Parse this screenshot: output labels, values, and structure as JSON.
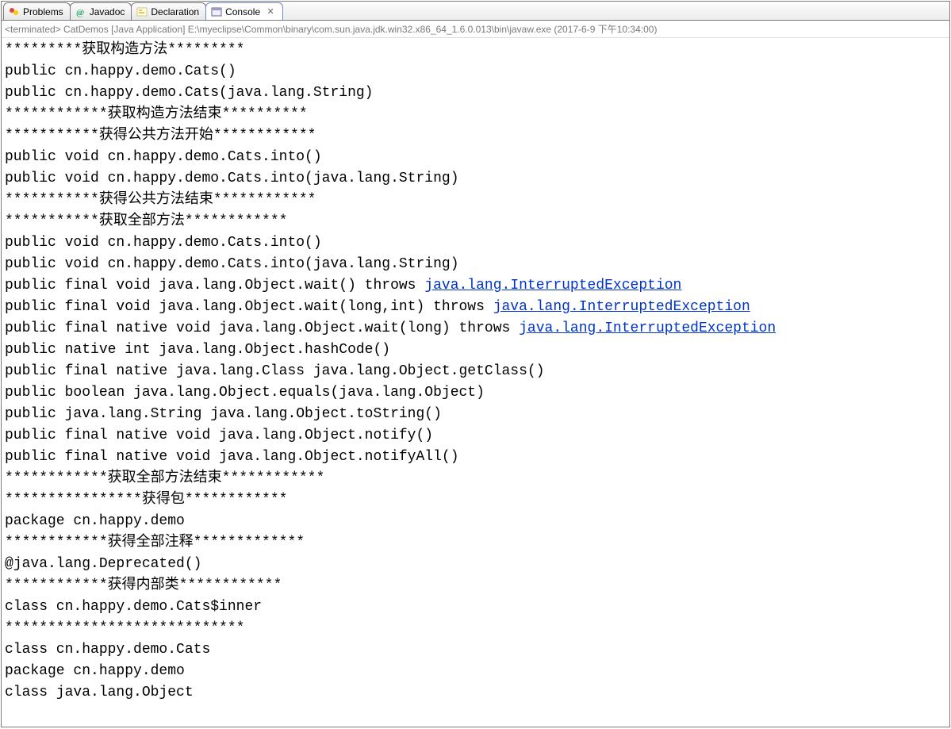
{
  "tabs": [
    {
      "id": "problems",
      "label": "Problems",
      "icon": "problems"
    },
    {
      "id": "javadoc",
      "label": "Javadoc",
      "icon": "javadoc"
    },
    {
      "id": "declaration",
      "label": "Declaration",
      "icon": "declaration"
    },
    {
      "id": "console",
      "label": "Console",
      "icon": "console",
      "active": true,
      "closable": true
    }
  ],
  "meta": "<terminated> CatDemos [Java Application] E:\\myeclipse\\Common\\binary\\com.sun.java.jdk.win32.x86_64_1.6.0.013\\bin\\javaw.exe (2017-6-9 下午10:34:00)",
  "console_lines": [
    {
      "segments": [
        {
          "text": "*********获取构造方法*********"
        }
      ]
    },
    {
      "segments": [
        {
          "text": "public cn.happy.demo.Cats()"
        }
      ]
    },
    {
      "segments": [
        {
          "text": "public cn.happy.demo.Cats(java.lang.String)"
        }
      ]
    },
    {
      "segments": [
        {
          "text": "************获取构造方法结束**********"
        }
      ]
    },
    {
      "segments": [
        {
          "text": "***********获得公共方法开始************"
        }
      ]
    },
    {
      "segments": [
        {
          "text": "public void cn.happy.demo.Cats.into()"
        }
      ]
    },
    {
      "segments": [
        {
          "text": "public void cn.happy.demo.Cats.into(java.lang.String)"
        }
      ]
    },
    {
      "segments": [
        {
          "text": "***********获得公共方法结束************"
        }
      ]
    },
    {
      "segments": [
        {
          "text": "***********获取全部方法************"
        }
      ]
    },
    {
      "segments": [
        {
          "text": "public void cn.happy.demo.Cats.into()"
        }
      ]
    },
    {
      "segments": [
        {
          "text": "public void cn.happy.demo.Cats.into(java.lang.String)"
        }
      ]
    },
    {
      "segments": [
        {
          "text": "public final void java.lang.Object.wait() throws "
        },
        {
          "text": "java.lang.InterruptedException",
          "link": true
        }
      ]
    },
    {
      "segments": [
        {
          "text": "public final void java.lang.Object.wait(long,int) throws "
        },
        {
          "text": "java.lang.InterruptedException",
          "link": true
        }
      ]
    },
    {
      "segments": [
        {
          "text": "public final native void java.lang.Object.wait(long) throws "
        },
        {
          "text": "java.lang.InterruptedException",
          "link": true
        }
      ]
    },
    {
      "segments": [
        {
          "text": "public native int java.lang.Object.hashCode()"
        }
      ]
    },
    {
      "segments": [
        {
          "text": "public final native java.lang.Class java.lang.Object.getClass()"
        }
      ]
    },
    {
      "segments": [
        {
          "text": "public boolean java.lang.Object.equals(java.lang.Object)"
        }
      ]
    },
    {
      "segments": [
        {
          "text": "public java.lang.String java.lang.Object.toString()"
        }
      ]
    },
    {
      "segments": [
        {
          "text": "public final native void java.lang.Object.notify()"
        }
      ]
    },
    {
      "segments": [
        {
          "text": "public final native void java.lang.Object.notifyAll()"
        }
      ]
    },
    {
      "segments": [
        {
          "text": "************获取全部方法结束************"
        }
      ]
    },
    {
      "segments": [
        {
          "text": "****************获得包************"
        }
      ]
    },
    {
      "segments": [
        {
          "text": "package cn.happy.demo"
        }
      ]
    },
    {
      "segments": [
        {
          "text": "************获得全部注释*************"
        }
      ]
    },
    {
      "segments": [
        {
          "text": "@java.lang.Deprecated()"
        }
      ]
    },
    {
      "segments": [
        {
          "text": "************获得内部类************"
        }
      ]
    },
    {
      "segments": [
        {
          "text": "class cn.happy.demo.Cats$inner"
        }
      ]
    },
    {
      "segments": [
        {
          "text": "****************************"
        }
      ]
    },
    {
      "segments": [
        {
          "text": "class cn.happy.demo.Cats"
        }
      ]
    },
    {
      "segments": [
        {
          "text": "package cn.happy.demo"
        }
      ]
    },
    {
      "segments": [
        {
          "text": "class java.lang.Object"
        }
      ]
    }
  ]
}
